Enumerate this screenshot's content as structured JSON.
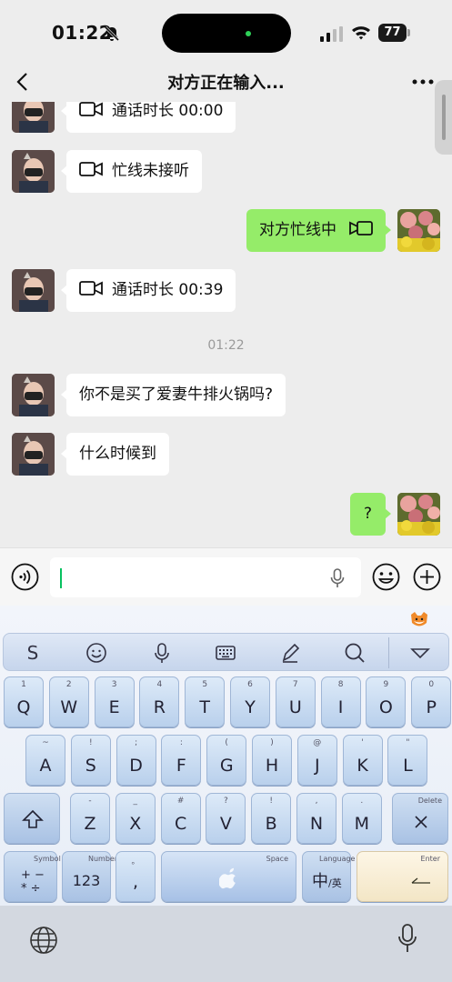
{
  "status_bar": {
    "time": "01:22",
    "battery": "77"
  },
  "nav": {
    "title": "对方正在输入..."
  },
  "messages": [
    {
      "side": "in",
      "type": "call",
      "text": "通话时长 00:00"
    },
    {
      "side": "in",
      "type": "call",
      "text": "忙线未接听"
    },
    {
      "side": "out",
      "type": "call",
      "text": "对方忙线中"
    },
    {
      "side": "in",
      "type": "call",
      "text": "通话时长 00:39"
    },
    {
      "side": "in",
      "type": "text",
      "text": "你不是买了爱妻牛排火锅吗?"
    },
    {
      "side": "in",
      "type": "text",
      "text": "什么时候到"
    },
    {
      "side": "out",
      "type": "text",
      "text": "?"
    }
  ],
  "timestamp": "01:22",
  "keyboard": {
    "row1": [
      {
        "sub": "1",
        "main": "Q"
      },
      {
        "sub": "2",
        "main": "W"
      },
      {
        "sub": "3",
        "main": "E"
      },
      {
        "sub": "4",
        "main": "R"
      },
      {
        "sub": "5",
        "main": "T"
      },
      {
        "sub": "6",
        "main": "Y"
      },
      {
        "sub": "7",
        "main": "U"
      },
      {
        "sub": "8",
        "main": "I"
      },
      {
        "sub": "9",
        "main": "O"
      },
      {
        "sub": "0",
        "main": "P"
      }
    ],
    "row2": [
      {
        "sub": "~",
        "main": "A"
      },
      {
        "sub": "!",
        "main": "S"
      },
      {
        "sub": ";",
        "main": "D"
      },
      {
        "sub": ":",
        "main": "F"
      },
      {
        "sub": "(",
        "main": "G"
      },
      {
        "sub": ")",
        "main": "H"
      },
      {
        "sub": "@",
        "main": "J"
      },
      {
        "sub": "'",
        "main": "K"
      },
      {
        "sub": "\"",
        "main": "L"
      }
    ],
    "row3": [
      {
        "sub": "-",
        "main": "Z"
      },
      {
        "sub": "_",
        "main": "X"
      },
      {
        "sub": "#",
        "main": "C"
      },
      {
        "sub": "?",
        "main": "V"
      },
      {
        "sub": "!",
        "main": "B"
      },
      {
        "sub": ",",
        "main": "N"
      },
      {
        "sub": ".",
        "main": "M"
      }
    ],
    "delete_label": "Delete",
    "symbol_label": "Symbol",
    "symbol_glyph_top": "+ −",
    "symbol_glyph_bottom": "* ÷",
    "number_label": "Number",
    "number_main": "123",
    "comma_sub": "。",
    "comma_main": ",",
    "space_label": "Space",
    "language_label": "Language",
    "lang_main": "中",
    "lang_sub": "/英",
    "enter_label": "Enter"
  },
  "icons": {
    "toolbar": [
      "sogou-s-icon",
      "emoji-icon",
      "mic-icon",
      "keyboard-icon",
      "pen-icon",
      "search-icon",
      "collapse-icon"
    ]
  },
  "colors": {
    "outgoing_bubble": "#95ec69",
    "incoming_bubble": "#ffffff",
    "caret": "#07c160"
  }
}
